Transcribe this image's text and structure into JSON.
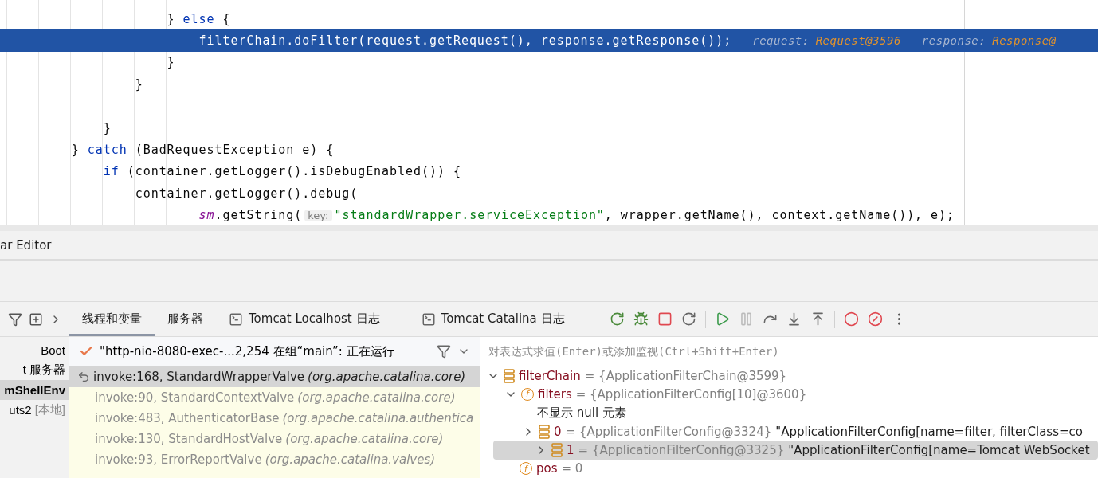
{
  "editor": {
    "lines": [
      {
        "highlighted": false,
        "tokens": [
          {
            "kind": "plain",
            "text": "                    } "
          },
          {
            "kind": "keyword",
            "text": "else"
          },
          {
            "kind": "plain",
            "text": " {"
          }
        ]
      },
      {
        "highlighted": true,
        "tokens": [
          {
            "kind": "plain",
            "text": "                        filterChain.doFilter(request.getRequest(), response.getResponse());"
          },
          {
            "kind": "hint",
            "text": "request:"
          },
          {
            "kind": "hint_value",
            "text": "Request@3596"
          },
          {
            "kind": "hint",
            "text": "response:"
          },
          {
            "kind": "hint_value",
            "text": "Response@"
          }
        ]
      },
      {
        "highlighted": false,
        "tokens": [
          {
            "kind": "plain",
            "text": "                    }"
          }
        ]
      },
      {
        "highlighted": false,
        "tokens": [
          {
            "kind": "plain",
            "text": "                }"
          }
        ]
      },
      {
        "highlighted": false
      },
      {
        "highlighted": false,
        "tokens": [
          {
            "kind": "plain",
            "text": "            }"
          }
        ]
      },
      {
        "highlighted": false,
        "tokens": [
          {
            "kind": "plain",
            "text": "        } "
          },
          {
            "kind": "keyword",
            "text": "catch"
          },
          {
            "kind": "plain",
            "text": " (BadRequestException e) {"
          }
        ]
      },
      {
        "highlighted": false,
        "tokens": [
          {
            "kind": "keyword",
            "text": "            if"
          },
          {
            "kind": "plain",
            "text": " (container.getLogger().isDebugEnabled()) {"
          }
        ]
      },
      {
        "highlighted": false,
        "tokens": [
          {
            "kind": "plain",
            "text": "                container.getLogger().debug("
          }
        ]
      },
      {
        "highlighted": false,
        "tokens": [
          {
            "kind": "field",
            "text": "                        sm"
          },
          {
            "kind": "plain",
            "text": ".getString("
          },
          {
            "kind": "param_hint",
            "text": "key:"
          },
          {
            "kind": "string",
            "text": "\"standardWrapper.serviceException\""
          },
          {
            "kind": "plain",
            "text": ", wrapper.getName(), context.getName()), e);"
          }
        ]
      }
    ]
  },
  "editor_tab_strip": {
    "label": "ar Editor"
  },
  "sidebar": {
    "items": [
      {
        "label": "Boot",
        "selected": false
      },
      {
        "label": "t 服务器",
        "selected": false
      },
      {
        "label": "mShellEnv",
        "selected": true
      },
      {
        "label": "uts2",
        "suffix": "[本地]",
        "selected": false
      }
    ]
  },
  "tabs": [
    {
      "label": "线程和变量",
      "selected": true,
      "kind": "plain"
    },
    {
      "label": "服务器",
      "selected": false,
      "kind": "plain"
    },
    {
      "label": "Tomcat Localhost 日志",
      "selected": false,
      "kind": "console"
    },
    {
      "label": "Tomcat Catalina 日志",
      "selected": false,
      "kind": "console"
    }
  ],
  "frames": {
    "thread": "\"http-nio-8080-exec-...2,254 在组“main”: 正在运行",
    "items": [
      {
        "method": "invoke:168, StandardWrapperValve",
        "package": "(org.apache.catalina.core)",
        "selected": true
      },
      {
        "method": "invoke:90, StandardContextValve",
        "package": "(org.apache.catalina.core)",
        "selected": false
      },
      {
        "method": "invoke:483, AuthenticatorBase",
        "package": "(org.apache.catalina.authentica",
        "selected": false
      },
      {
        "method": "invoke:130, StandardHostValve",
        "package": "(org.apache.catalina.core)",
        "selected": false
      },
      {
        "method": "invoke:93, ErrorReportValve",
        "package": "(org.apache.catalina.valves)",
        "selected": false
      }
    ]
  },
  "variables": {
    "placeholder": "对表达式求值(Enter)或添加监视(Ctrl+Shift+Enter)",
    "tree": [
      {
        "kind": "object",
        "name": "filterChain",
        "value": "= {ApplicationFilterChain@3599}",
        "expanded": true,
        "selected": false,
        "children": [
          {
            "kind": "field",
            "badge": "f",
            "name": "filters",
            "value": "= {ApplicationFilterConfig[10]@3600}",
            "expanded": true,
            "selected": false,
            "children": [
              {
                "kind": "note",
                "name": "不显示 null 元素",
                "selected": false
              },
              {
                "kind": "object",
                "name": "0",
                "value": "= {ApplicationFilterConfig@3324}",
                "string": "\"ApplicationFilterConfig[name=filter, filterClass=co",
                "expanded": false,
                "selected": false
              },
              {
                "kind": "object",
                "name": "1",
                "value": "= {ApplicationFilterConfig@3325}",
                "string": "\"ApplicationFilterConfig[name=Tomcat WebSocket",
                "expanded": false,
                "selected": true
              }
            ]
          },
          {
            "kind": "field",
            "badge": "f",
            "name": "pos",
            "value": "= 0",
            "selected": false
          }
        ]
      }
    ]
  }
}
